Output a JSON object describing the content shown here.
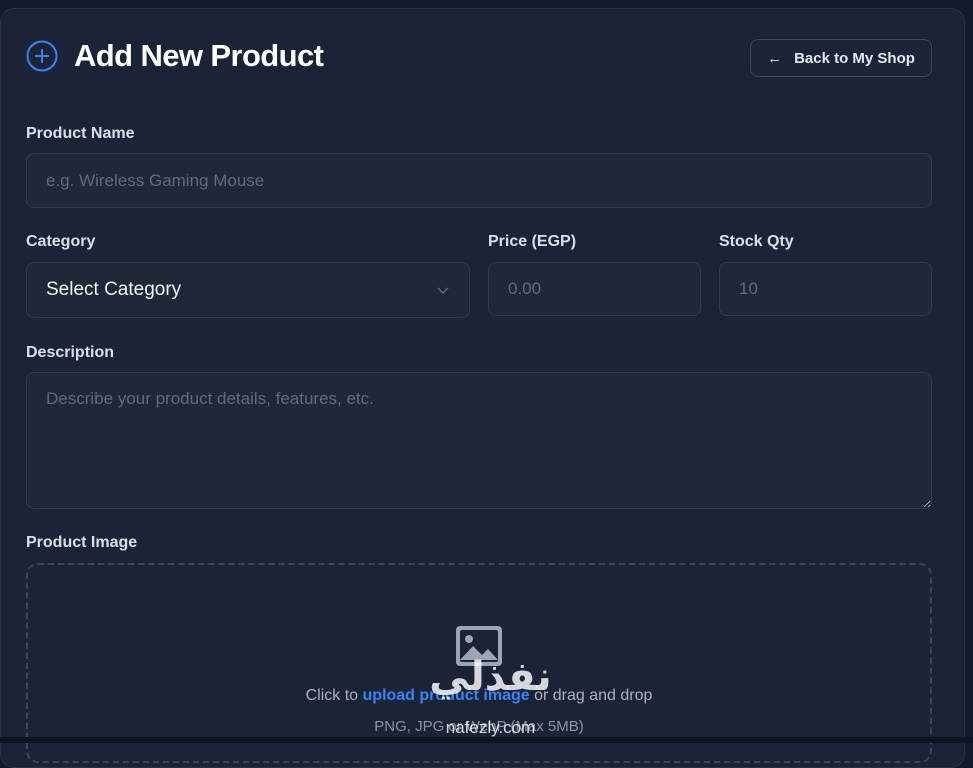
{
  "header": {
    "title": "Add New Product",
    "back_label": "Back to My Shop"
  },
  "form": {
    "product_name": {
      "label": "Product Name",
      "placeholder": "e.g. Wireless Gaming Mouse"
    },
    "category": {
      "label": "Category",
      "selected": "Select Category"
    },
    "price": {
      "label": "Price (EGP)",
      "placeholder": "0.00"
    },
    "stock": {
      "label": "Stock Qty",
      "placeholder": "10"
    },
    "description": {
      "label": "Description",
      "placeholder": "Describe your product details, features, etc."
    },
    "image": {
      "label": "Product Image",
      "prefix": "Click to ",
      "link": "upload product image",
      "suffix": " or drag and drop",
      "formats": "PNG, JPG or WebP (Max 5MB)"
    }
  },
  "watermark": {
    "arabic": "نفذلي",
    "latin": "nafezly.com"
  },
  "icons": {
    "title": "plus-circle-icon",
    "back": "arrow-left-icon",
    "select": "chevron-down-icon",
    "upload": "image-icon"
  },
  "colors": {
    "accent": "#3b82f6",
    "background": "#1a2436"
  }
}
